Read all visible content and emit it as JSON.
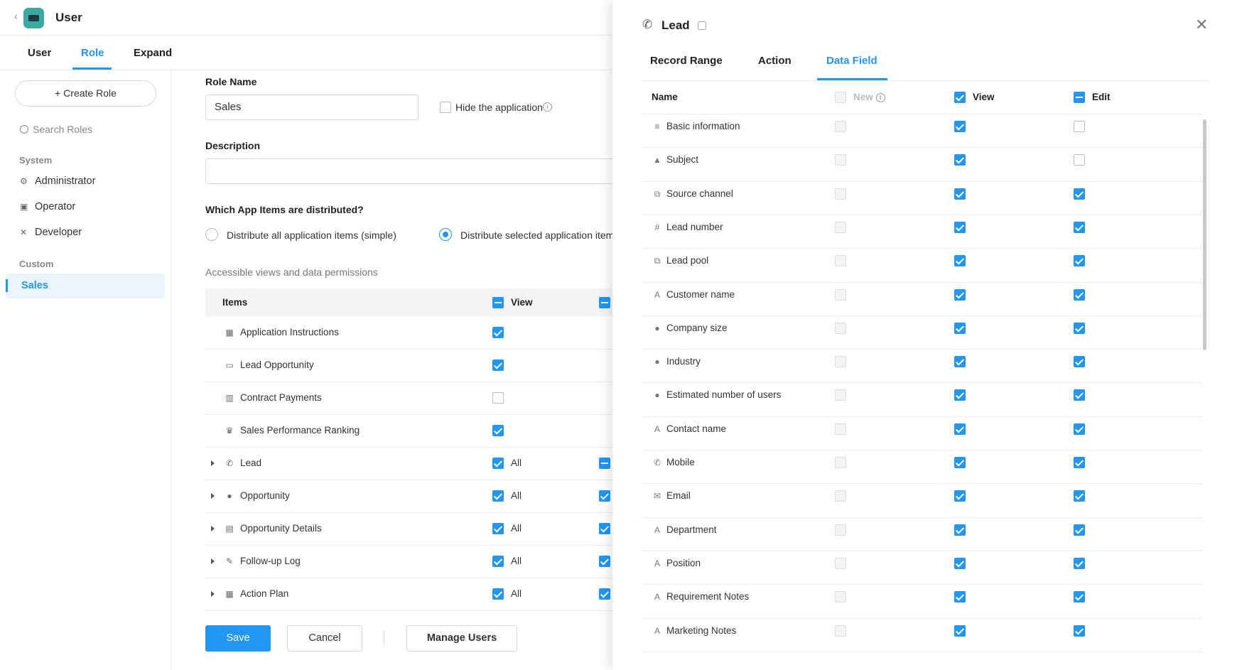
{
  "header": {
    "title": "User"
  },
  "main_tabs": [
    {
      "label": "User"
    },
    {
      "label": "Role"
    },
    {
      "label": "Expand"
    }
  ],
  "sidebar": {
    "create_role": "+ Create Role",
    "search_placeholder": "Search Roles",
    "system_label": "System",
    "system_items": [
      "Administrator",
      "Operator",
      "Developer"
    ],
    "custom_label": "Custom",
    "custom_items": [
      "Sales"
    ]
  },
  "form": {
    "role_name_label": "Role Name",
    "role_name_value": "Sales",
    "hide_app_label": "Hide the application",
    "description_label": "Description",
    "description_value": "",
    "distribution_question": "Which App Items are distributed?",
    "radio_all": "Distribute all application items (simple)",
    "radio_selected": "Distribute selected application item",
    "accessible_label": "Accessible views and data permissions",
    "items_header": "Items",
    "view_header": "View",
    "items": [
      {
        "name": "Application Instructions",
        "icon": "grid-icon",
        "view": true,
        "all": ""
      },
      {
        "name": "Lead Opportunity",
        "icon": "presentation-icon",
        "view": true,
        "all": ""
      },
      {
        "name": "Contract Payments",
        "icon": "chart-icon",
        "view": false,
        "all": ""
      },
      {
        "name": "Sales Performance Ranking",
        "icon": "trophy-icon",
        "view": true,
        "all": ""
      },
      {
        "name": "Lead",
        "icon": "phone-icon",
        "view": true,
        "all": "All"
      },
      {
        "name": "Opportunity",
        "icon": "chat-icon",
        "view": true,
        "all": "All"
      },
      {
        "name": "Opportunity Details",
        "icon": "document-icon",
        "view": true,
        "all": "All"
      },
      {
        "name": "Follow-up Log",
        "icon": "edit-icon",
        "view": true,
        "all": "All"
      },
      {
        "name": "Action Plan",
        "icon": "calendar-icon",
        "view": true,
        "all": "All"
      }
    ],
    "save": "Save",
    "cancel": "Cancel",
    "manage_users": "Manage Users"
  },
  "drawer": {
    "title": "Lead",
    "tabs": [
      "Record Range",
      "Action",
      "Data Field"
    ],
    "active_tab": "Data Field",
    "headers": {
      "name": "Name",
      "new": "New",
      "view": "View",
      "edit": "Edit"
    },
    "fields": [
      {
        "name": "Basic information",
        "icon": "lines-icon",
        "view": true,
        "edit": false
      },
      {
        "name": "Subject",
        "icon": "shapes-icon",
        "view": true,
        "edit": false
      },
      {
        "name": "Source channel",
        "icon": "link-icon",
        "view": true,
        "edit": true
      },
      {
        "name": "Lead number",
        "icon": "hash-icon",
        "view": true,
        "edit": true
      },
      {
        "name": "Lead pool",
        "icon": "link-icon",
        "view": true,
        "edit": true
      },
      {
        "name": "Customer name",
        "icon": "text-icon",
        "view": true,
        "edit": true
      },
      {
        "name": "Company size",
        "icon": "dropdown-icon",
        "view": true,
        "edit": true
      },
      {
        "name": "Industry",
        "icon": "dropdown-icon",
        "view": true,
        "edit": true
      },
      {
        "name": "Estimated number of users",
        "icon": "dropdown-icon",
        "view": true,
        "edit": true
      },
      {
        "name": "Contact name",
        "icon": "text-icon",
        "view": true,
        "edit": true
      },
      {
        "name": "Mobile",
        "icon": "phone-icon",
        "view": true,
        "edit": true
      },
      {
        "name": "Email",
        "icon": "mail-icon",
        "view": true,
        "edit": true
      },
      {
        "name": "Department",
        "icon": "text-icon",
        "view": true,
        "edit": true
      },
      {
        "name": "Position",
        "icon": "text-icon",
        "view": true,
        "edit": true
      },
      {
        "name": "Requirement Notes",
        "icon": "text-icon",
        "view": true,
        "edit": true
      },
      {
        "name": "Marketing Notes",
        "icon": "text-icon",
        "view": true,
        "edit": true
      }
    ]
  },
  "colors": {
    "accent": "#2196f3",
    "logo": "#3aa99f"
  }
}
